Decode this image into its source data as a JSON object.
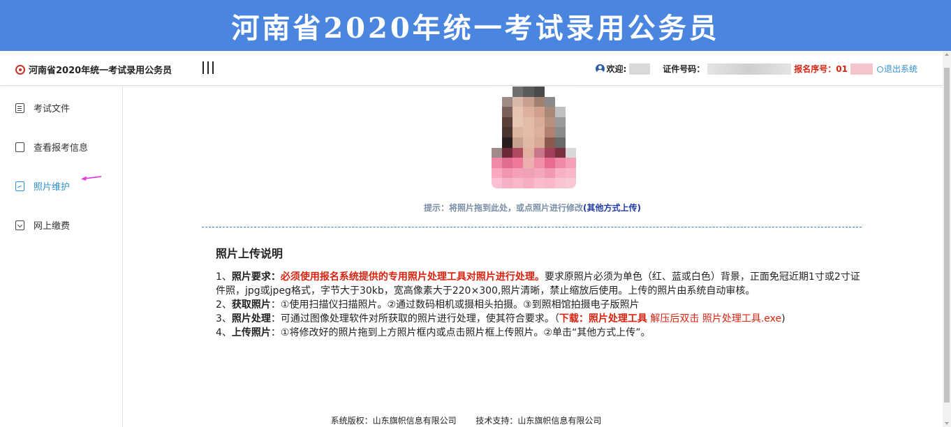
{
  "banner": {
    "title": "河南省2020年统一考试录用公务员"
  },
  "topbar": {
    "brand": "河南省2020年统一考试录用公务员",
    "welcome_label": "欢迎:",
    "id_label": "证件号码：",
    "regno_label": "报名序号：01",
    "logout_label": "退出系统"
  },
  "sidebar": {
    "items": [
      {
        "label": "考试文件",
        "icon": "document-icon"
      },
      {
        "label": "查看报考信息",
        "icon": "profile-icon"
      },
      {
        "label": "照片维护",
        "icon": "photo-icon",
        "active": true
      },
      {
        "label": "网上缴费",
        "icon": "payment-icon"
      }
    ]
  },
  "photo": {
    "hint_text": "提示：将照片拖到此处，或点照片进行修改",
    "hint_link": "其他方式上传"
  },
  "instructions": {
    "title": "照片上传说明",
    "p1_prefix": "1、",
    "p1_key": "照片要求：",
    "p1_red": "必须使用报名系统提供的专用照片处理工具对照片进行处理。",
    "p1_text": "要求原照片必须为单色（红、蓝或白色）背景，正面免冠近期1寸或2寸证件照，jpg或jpeg格式，字节大于30kb，宽高像素大于220×300,照片清晰，禁止缩放后使用。上传的照片由系统自动审核。",
    "p2_prefix": "2、",
    "p2_key": "获取照片",
    "p2_text": "：①使用扫描仪扫描照片。②通过数码相机或摄相头拍摄。③到照相馆拍摄电子版照片",
    "p3_prefix": "3、",
    "p3_key": "照片处理",
    "p3_text": "：可通过图像处理软件对所获取的照片进行处理，使其符合要求。（",
    "p3_download": "下载：照片处理工具",
    "p3_note": " 解压后双击 照片处理工具.exe",
    "p3_close": ")",
    "p4_prefix": "4、",
    "p4_key": "上传照片",
    "p4_text": "：①将修改好的照片拖到上方照片框内或点击照片框上传照片。②单击“其他方式上传”。"
  },
  "footer": {
    "copyright": "系统版权：山东旗帜信息有限公司",
    "support": "技术支持：山东旗帜信息有限公司"
  },
  "colors": {
    "banner_bg": "#4a86e0",
    "accent_blue": "#2f8fd1",
    "accent_red": "#d9230f",
    "arrow_magenta": "#e040e0"
  }
}
